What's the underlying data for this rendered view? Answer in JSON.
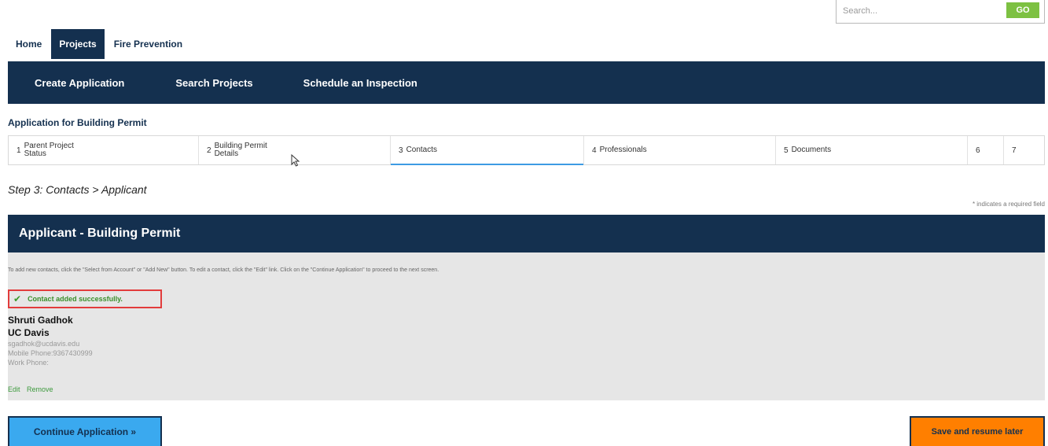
{
  "search": {
    "placeholder": "Search...",
    "button_label": "GO"
  },
  "top_tabs": [
    {
      "label": "Home"
    },
    {
      "label": "Projects",
      "active": true
    },
    {
      "label": "Fire Prevention"
    }
  ],
  "nav": [
    "Create Application",
    "Search Projects",
    "Schedule an Inspection"
  ],
  "application_title": "Application for Building Permit",
  "steps": [
    {
      "num": "1",
      "label": "Parent Project Status"
    },
    {
      "num": "2",
      "label": "Building Permit Details"
    },
    {
      "num": "3",
      "label": "Contacts",
      "active": true
    },
    {
      "num": "4",
      "label": "Professionals"
    },
    {
      "num": "5",
      "label": "Documents"
    },
    {
      "num": "6",
      "label": ""
    },
    {
      "num": "7",
      "label": ""
    }
  ],
  "step_heading": "Step 3: Contacts > Applicant",
  "required_note": "* indicates a required field",
  "panel": {
    "title": "Applicant - Building Permit",
    "instructions": "To add new contacts, click the \"Select from Account\" or \"Add New\" button. To edit a contact, click the \"Edit\" link. Click on the \"Continue Application\" to proceed to the next screen.",
    "success_message": "Contact added successfully."
  },
  "contact": {
    "name": "Shruti  Gadhok",
    "organization": "UC Davis",
    "email": "sgadhok@ucdavis.edu",
    "mobile_phone": "Mobile Phone:9367430999",
    "work_phone": "Work Phone:",
    "edit_label": "Edit",
    "remove_label": "Remove"
  },
  "buttons": {
    "continue_label": "Continue Application »",
    "save_label": "Save and resume later"
  },
  "colors": {
    "navy": "#14304f",
    "success_green": "#3a8f2a",
    "highlight_red": "#e23c3c",
    "continue_blue": "#3aa9ef",
    "save_orange": "#ff7f00"
  }
}
